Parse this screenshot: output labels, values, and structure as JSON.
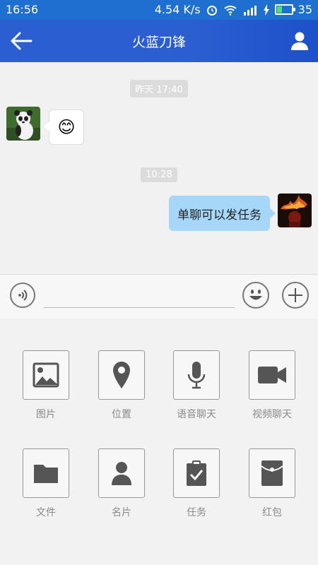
{
  "status_bar": {
    "time": "16:56",
    "speed": "4.54 K/s",
    "battery": "35"
  },
  "header": {
    "title": "火蓝刀锋"
  },
  "chat": {
    "timestamps": [
      "昨天 17:40",
      "10:28"
    ],
    "messages": [
      {
        "side": "left",
        "type": "emoji",
        "content": "😊"
      },
      {
        "side": "right",
        "type": "text",
        "content": "单聊可以发任务"
      }
    ]
  },
  "panel": {
    "items": [
      {
        "label": "图片",
        "icon": "image-icon"
      },
      {
        "label": "位置",
        "icon": "location-pin-icon"
      },
      {
        "label": "语音聊天",
        "icon": "microphone-icon"
      },
      {
        "label": "视频聊天",
        "icon": "video-camera-icon"
      },
      {
        "label": "文件",
        "icon": "folder-icon"
      },
      {
        "label": "名片",
        "icon": "contact-card-icon"
      },
      {
        "label": "任务",
        "icon": "task-clipboard-icon"
      },
      {
        "label": "红包",
        "icon": "red-envelope-icon"
      }
    ]
  },
  "colors": {
    "status_bar": "#1e6fd0",
    "app_bar": "#2b5fd1",
    "outgoing_bubble": "#a7d7f8"
  }
}
